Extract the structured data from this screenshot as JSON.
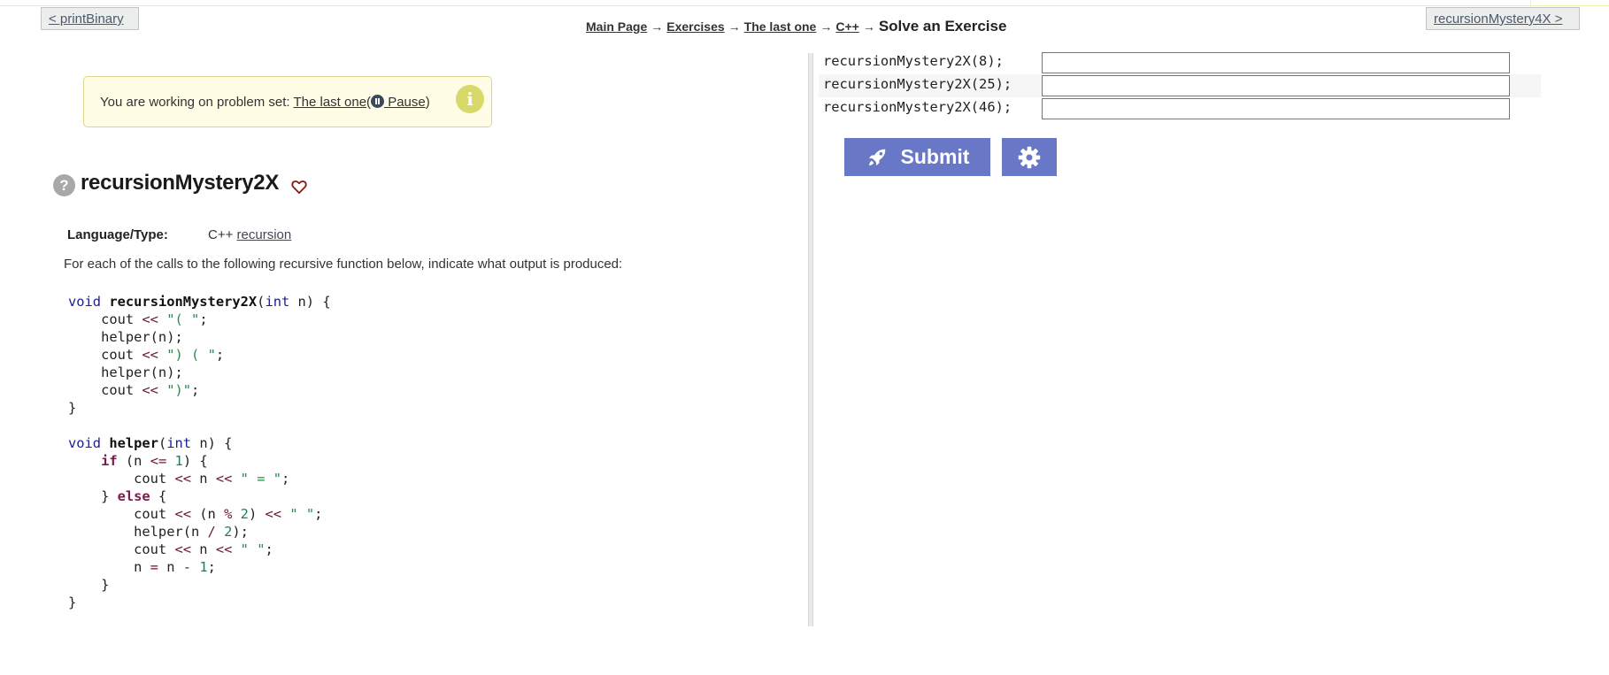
{
  "nav": {
    "prev_label": "< printBinary",
    "next_label": "recursionMystery4X >"
  },
  "breadcrumb": {
    "items": [
      "Main Page",
      "Exercises",
      "The last one",
      "C++"
    ],
    "separator": "→",
    "current": "Solve an Exercise"
  },
  "notice": {
    "prefix": "You are working on problem set:",
    "set_link": "The last one",
    "open_paren": "(",
    "pause_label": " Pause",
    "close_paren": ")"
  },
  "problem": {
    "help_icon": "?",
    "title": "recursionMystery2X",
    "language_label": "Language/Type:",
    "language": "C++",
    "type_link": "recursion",
    "description": "For each of the calls to the following recursive function below, indicate what output is produced:"
  },
  "code_lines": [
    "void recursionMystery2X(int n) {",
    "    cout << \"( \";",
    "    helper(n);",
    "    cout << \") ( \";",
    "    helper(n);",
    "    cout << \")\";",
    "}",
    "",
    "void helper(int n) {",
    "    if (n <= 1) {",
    "        cout << n << \" = \";",
    "    } else {",
    "        cout << (n % 2) << \" \";",
    "        helper(n / 2);",
    "        cout << n << \" \";",
    "        n = n - 1;",
    "    }",
    "}"
  ],
  "calls": [
    {
      "code": "recursionMystery2X(8);",
      "value": ""
    },
    {
      "code": "recursionMystery2X(25);",
      "value": ""
    },
    {
      "code": "recursionMystery2X(46);",
      "value": ""
    }
  ],
  "actions": {
    "submit_label": "Submit",
    "submit_icon": "rocket-icon",
    "settings_icon": "gear-icon"
  },
  "colors": {
    "accent": "#6877c6",
    "notice_bg": "#fffde6",
    "notice_border": "#dcd590",
    "info_icon": "#d9d86a"
  }
}
